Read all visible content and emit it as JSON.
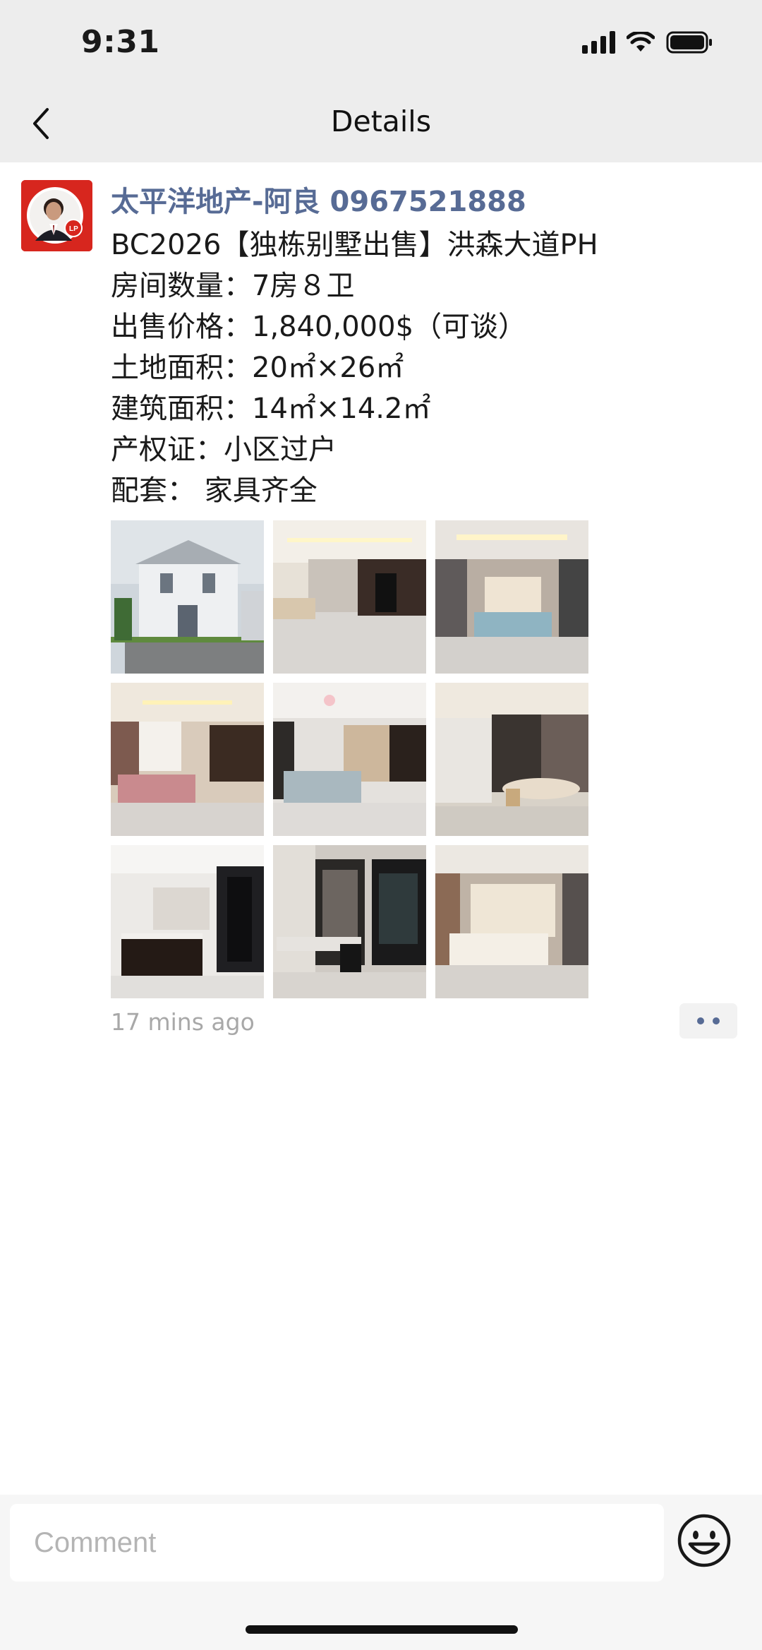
{
  "status_bar": {
    "time": "9:31"
  },
  "nav": {
    "title": "Details"
  },
  "post": {
    "author": "太平洋地产-阿良 0967521888",
    "lines": [
      "BC2026【独栋别墅出售】洪森大道PH",
      "房间数量：7房８卫",
      "出售价格：1,840,000$（可谈）",
      "土地面积：20㎡×26㎡",
      "建筑面积：14㎡×14.2㎡",
      "产权证：小区过户",
      "配套： 家具齐全"
    ],
    "images": [
      "villa-exterior",
      "living-room",
      "bedroom-grey",
      "bedroom-pink",
      "bedroom-desk",
      "dining-room",
      "kitchen",
      "study-room",
      "bedroom-cream"
    ],
    "timestamp": "17 mins ago"
  },
  "comment": {
    "placeholder": "Comment"
  },
  "colors": {
    "link": "#576b95",
    "header_bg": "#ededed",
    "avatar_red": "#d7261e"
  }
}
